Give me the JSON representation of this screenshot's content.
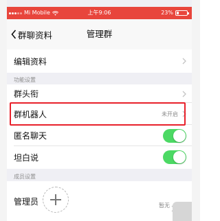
{
  "status_bar": {
    "carrier": "Mi Mobile",
    "time": "上午9:06",
    "battery_percent": "23%",
    "battery_level": 0.23
  },
  "nav": {
    "back_label": "群聊资料",
    "title": "管理群"
  },
  "rows": {
    "edit_info": {
      "label": "编辑资料"
    },
    "group_title": {
      "label": "群头衔"
    },
    "group_robot": {
      "label": "群机器人",
      "value": "未开启"
    },
    "anonymous_chat": {
      "label": "匿名聊天",
      "enabled": true
    },
    "honest_talk": {
      "label": "坦白说",
      "enabled": true
    },
    "admin": {
      "label": "管理员",
      "value": "暂无"
    }
  },
  "sections": {
    "features": "功能设置",
    "members": "成员设置"
  },
  "colors": {
    "status_bar": "#e8453c",
    "toggle_on": "#4cd964",
    "highlight": "#e8202a"
  },
  "icons": {
    "back": "chevron-left-icon",
    "row_arrow": "chevron-right-icon",
    "add": "plus-icon",
    "wifi": "wifi-icon"
  }
}
